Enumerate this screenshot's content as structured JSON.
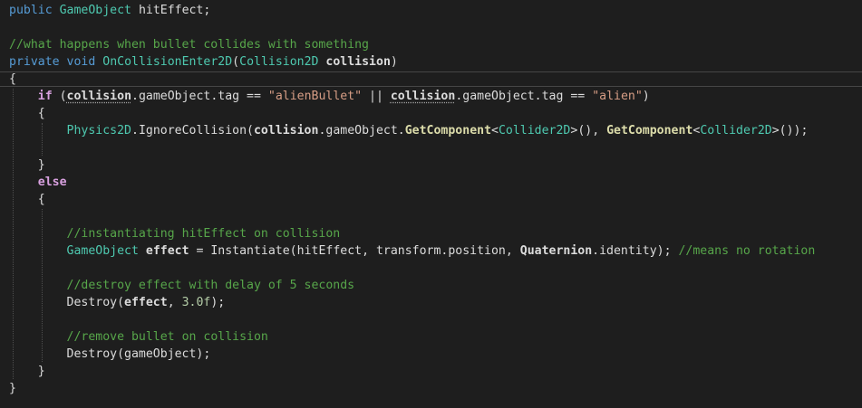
{
  "editor": {
    "lines": [
      [
        [
          "kw",
          "public"
        ],
        [
          "pln",
          " "
        ],
        [
          "type",
          "GameObject"
        ],
        [
          "pln",
          " hitEffect;"
        ]
      ],
      [],
      [
        [
          "cmt",
          "//what happens when bullet collides with something"
        ]
      ],
      [
        [
          "kw",
          "private"
        ],
        [
          "pln",
          " "
        ],
        [
          "kw",
          "void"
        ],
        [
          "pln",
          " "
        ],
        [
          "type",
          "OnCollisionEnter2D"
        ],
        [
          "pln",
          "("
        ],
        [
          "type",
          "Collision2D"
        ],
        [
          "pln",
          " "
        ],
        [
          "bold",
          "collision"
        ],
        [
          "pln",
          ")"
        ]
      ],
      [
        [
          "pln",
          "{"
        ]
      ],
      [
        [
          "pln",
          "    "
        ],
        [
          "ctl",
          "if"
        ],
        [
          "pln",
          " ("
        ],
        [
          "bold squig",
          "collision"
        ],
        [
          "pln",
          ".gameObject.tag == "
        ],
        [
          "str",
          "\"alienBullet\""
        ],
        [
          "pln",
          " || "
        ],
        [
          "bold squig",
          "collision"
        ],
        [
          "pln",
          ".gameObject.tag == "
        ],
        [
          "str",
          "\"alien\""
        ],
        [
          "pln",
          ")"
        ]
      ],
      [
        [
          "pln",
          "    {"
        ]
      ],
      [
        [
          "pln",
          "        "
        ],
        [
          "type",
          "Physics2D"
        ],
        [
          "pln",
          ".IgnoreCollision("
        ],
        [
          "bold",
          "collision"
        ],
        [
          "pln",
          ".gameObject."
        ],
        [
          "meth",
          "GetComponent"
        ],
        [
          "pln",
          "<"
        ],
        [
          "type",
          "Collider2D"
        ],
        [
          "pln",
          ">(), "
        ],
        [
          "meth",
          "GetComponent"
        ],
        [
          "pln",
          "<"
        ],
        [
          "type",
          "Collider2D"
        ],
        [
          "pln",
          ">());"
        ]
      ],
      [],
      [
        [
          "pln",
          "    }"
        ]
      ],
      [
        [
          "pln",
          "    "
        ],
        [
          "ctl",
          "else"
        ]
      ],
      [
        [
          "pln",
          "    {"
        ]
      ],
      [],
      [
        [
          "pln",
          "        "
        ],
        [
          "cmt",
          "//instantiating hitEffect on collision"
        ]
      ],
      [
        [
          "pln",
          "        "
        ],
        [
          "type",
          "GameObject"
        ],
        [
          "pln",
          " "
        ],
        [
          "bold",
          "effect"
        ],
        [
          "pln",
          " = Instantiate(hitEffect, transform.position, "
        ],
        [
          "type bold",
          "Quaternion"
        ],
        [
          "pln",
          ".identity); "
        ],
        [
          "cmt",
          "//means no rotation"
        ]
      ],
      [],
      [
        [
          "pln",
          "        "
        ],
        [
          "cmt",
          "//destroy effect with delay of 5 seconds"
        ]
      ],
      [
        [
          "pln",
          "        Destroy("
        ],
        [
          "bold",
          "effect"
        ],
        [
          "pln",
          ", "
        ],
        [
          "num",
          "3.0f"
        ],
        [
          "pln",
          ");"
        ]
      ],
      [],
      [
        [
          "pln",
          "        "
        ],
        [
          "cmt",
          "//remove bullet on collision"
        ]
      ],
      [
        [
          "pln",
          "        Destroy(gameObject);"
        ]
      ],
      [
        [
          "pln",
          "    }"
        ]
      ],
      [
        [
          "pln",
          "}"
        ]
      ]
    ]
  }
}
